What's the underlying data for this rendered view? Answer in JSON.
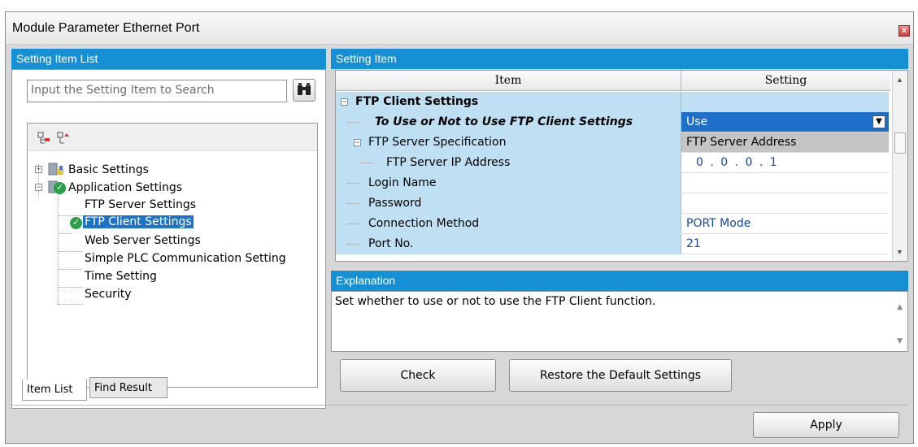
{
  "window": {
    "title": "Module Parameter Ethernet Port",
    "close": "x"
  },
  "left": {
    "header": "Setting Item List",
    "search_placeholder": "Input the Setting Item to Search",
    "tree": [
      {
        "label": "Basic Settings"
      },
      {
        "label": "Application Settings"
      },
      {
        "label": "FTP Server Settings"
      },
      {
        "label": "FTP Client Settings"
      },
      {
        "label": "Web Server Settings"
      },
      {
        "label": "Simple PLC Communication Setting"
      },
      {
        "label": "Time Setting"
      },
      {
        "label": "Security"
      }
    ],
    "tabs": [
      "Item List",
      "Find Result"
    ]
  },
  "right": {
    "header": "Setting Item",
    "columns": [
      "Item",
      "Setting"
    ],
    "rows": [
      {
        "item": "FTP Client Settings",
        "setting": ""
      },
      {
        "item": "To Use or Not to Use FTP Client Settings",
        "setting": "Use"
      },
      {
        "item": "FTP Server Specification",
        "setting": "FTP Server Address"
      },
      {
        "item": "FTP Server IP Address",
        "setting": "0 .  0 .  0 .  1"
      },
      {
        "item": "Login Name",
        "setting": ""
      },
      {
        "item": "Password",
        "setting": ""
      },
      {
        "item": "Connection Method",
        "setting": "PORT Mode"
      },
      {
        "item": "Port No.",
        "setting": "21"
      }
    ]
  },
  "explanation": {
    "header": "Explanation",
    "text": "Set whether to use or not to use the FTP Client function."
  },
  "buttons": {
    "check": "Check",
    "restore": "Restore the Default Settings",
    "apply": "Apply"
  },
  "colors": {
    "header_blue": "#1590d4",
    "row_blue": "#bfe0f2",
    "selected_blue": "#1e6fc9",
    "value_blue": "#1546a8",
    "check_green": "#2aa04a"
  }
}
